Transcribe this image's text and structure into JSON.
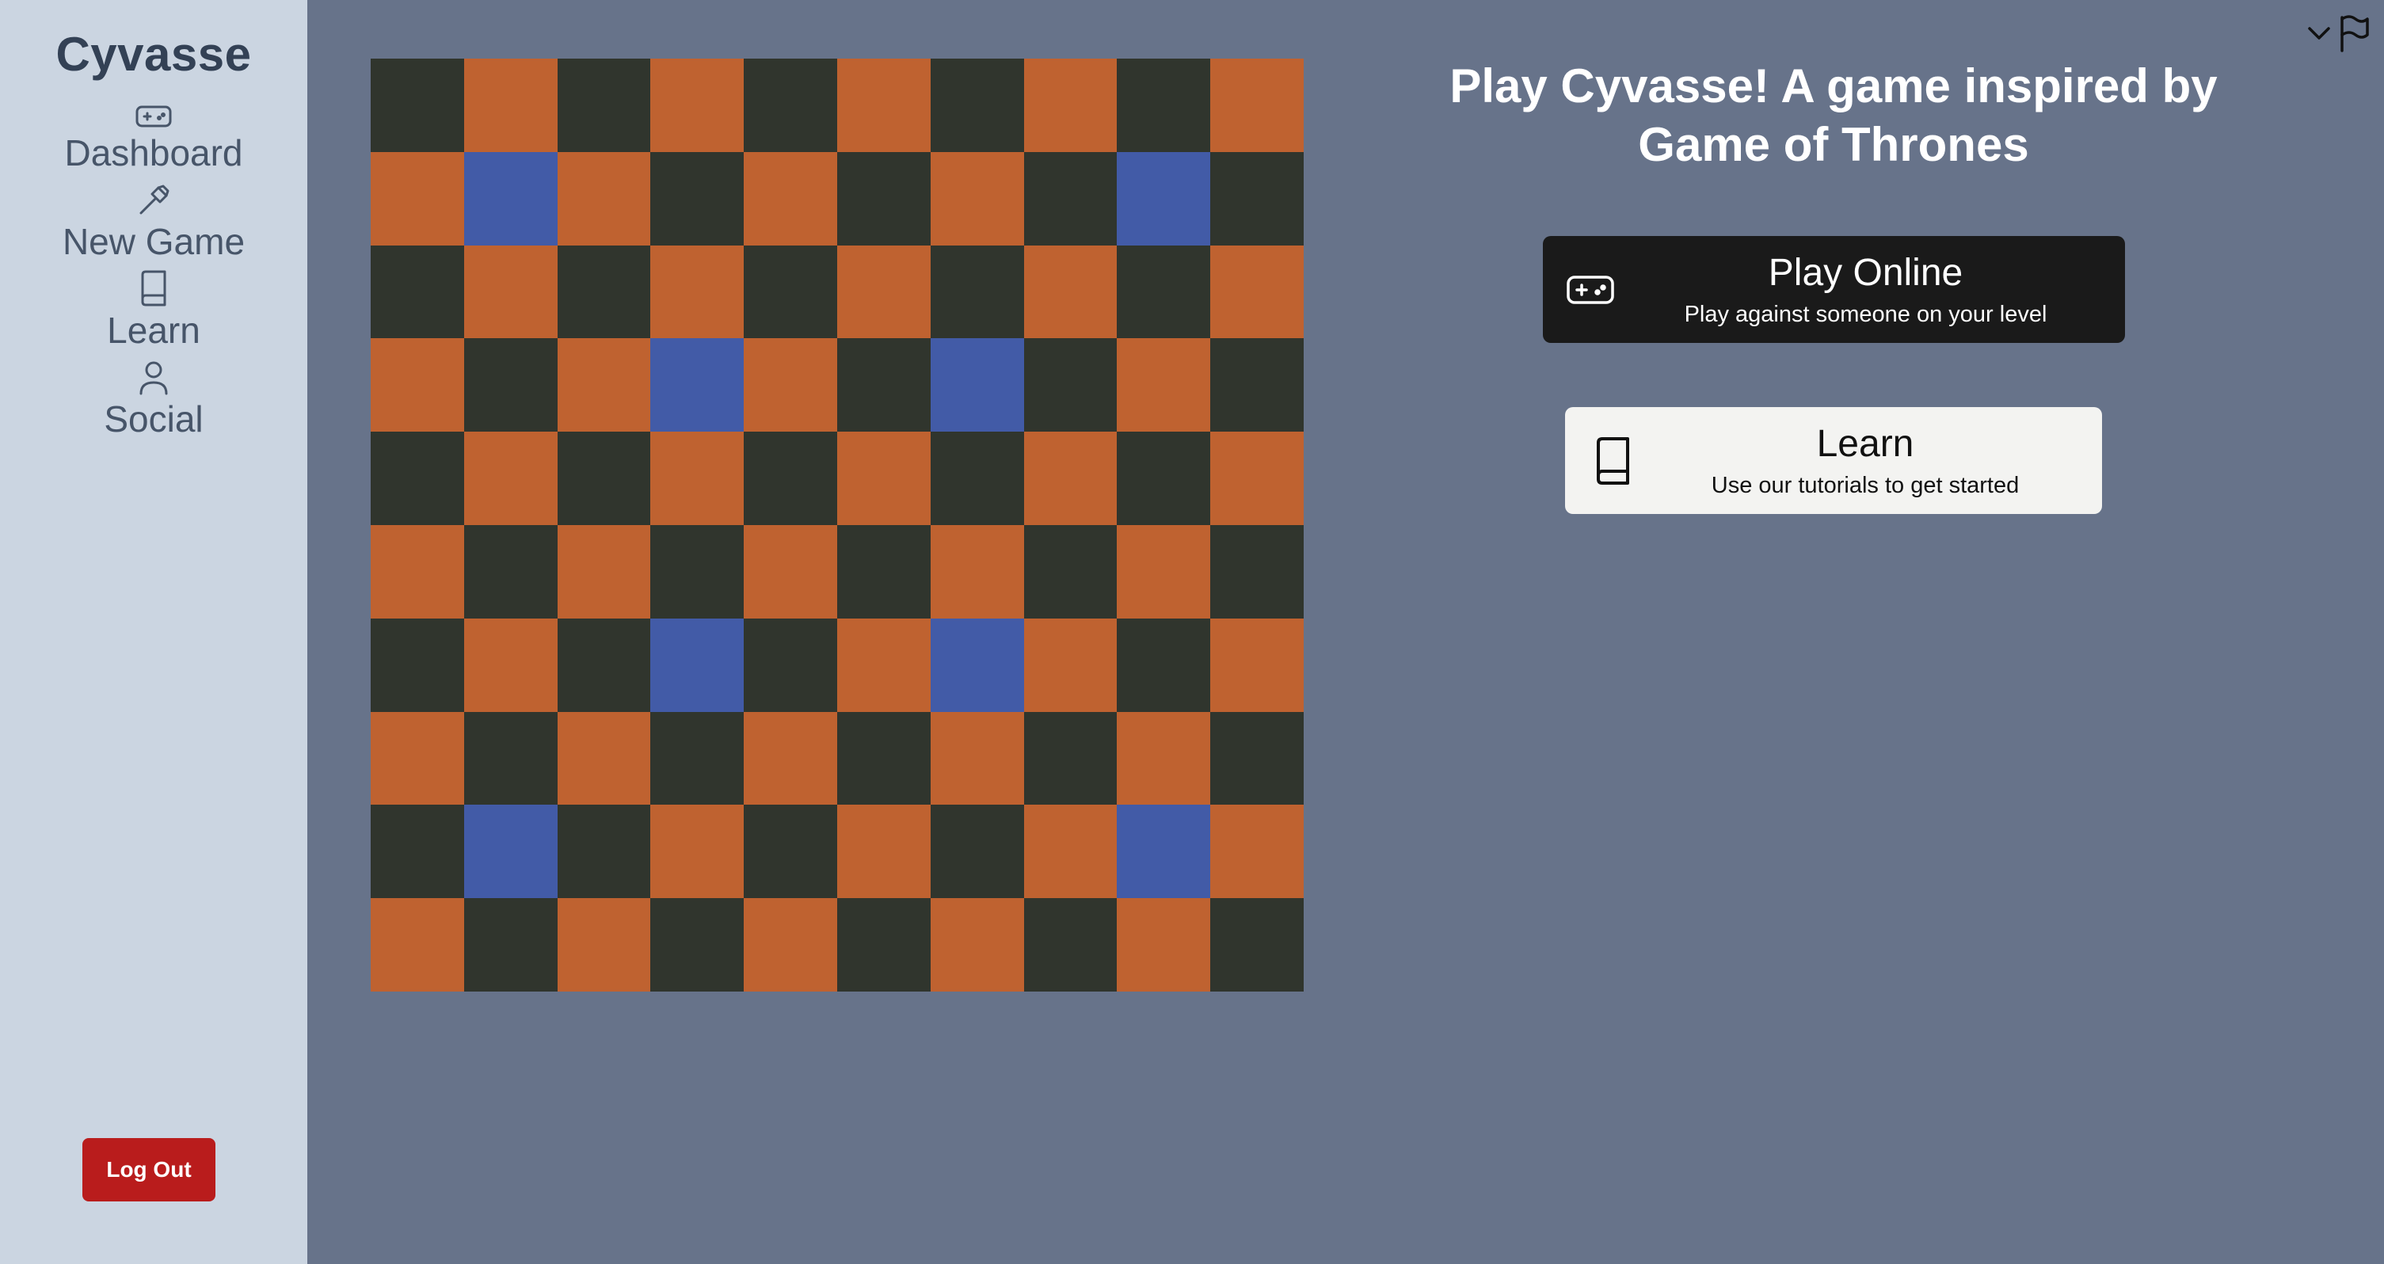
{
  "sidebar": {
    "brand": "Cyvasse",
    "items": [
      {
        "label": "Dashboard",
        "icon": "gamepad-icon"
      },
      {
        "label": "New Game",
        "icon": "hammer-icon"
      },
      {
        "label": "Learn",
        "icon": "book-icon"
      },
      {
        "label": "Social",
        "icon": "user-icon"
      }
    ],
    "logout_label": "Log Out"
  },
  "main": {
    "headline": "Play Cyvasse! A game inspired by Game of Thrones",
    "cards": [
      {
        "title": "Play Online",
        "subtitle": "Play against someone on your level",
        "icon": "gamepad-icon"
      },
      {
        "title": "Learn",
        "subtitle": "Use our tutorials to get started",
        "icon": "book-icon"
      }
    ]
  },
  "board": {
    "size": 10,
    "highlighted_squares": [
      [
        1,
        1
      ],
      [
        1,
        8
      ],
      [
        3,
        3
      ],
      [
        3,
        6
      ],
      [
        6,
        3
      ],
      [
        6,
        6
      ],
      [
        8,
        1
      ],
      [
        8,
        8
      ]
    ]
  },
  "colors": {
    "board_dark": "#30352d",
    "board_light": "#bf6230",
    "board_highlight": "#425ba7",
    "logout": "#b91c1c"
  },
  "topbar": {
    "icons": [
      "chevron-down-icon",
      "flag-icon"
    ]
  }
}
